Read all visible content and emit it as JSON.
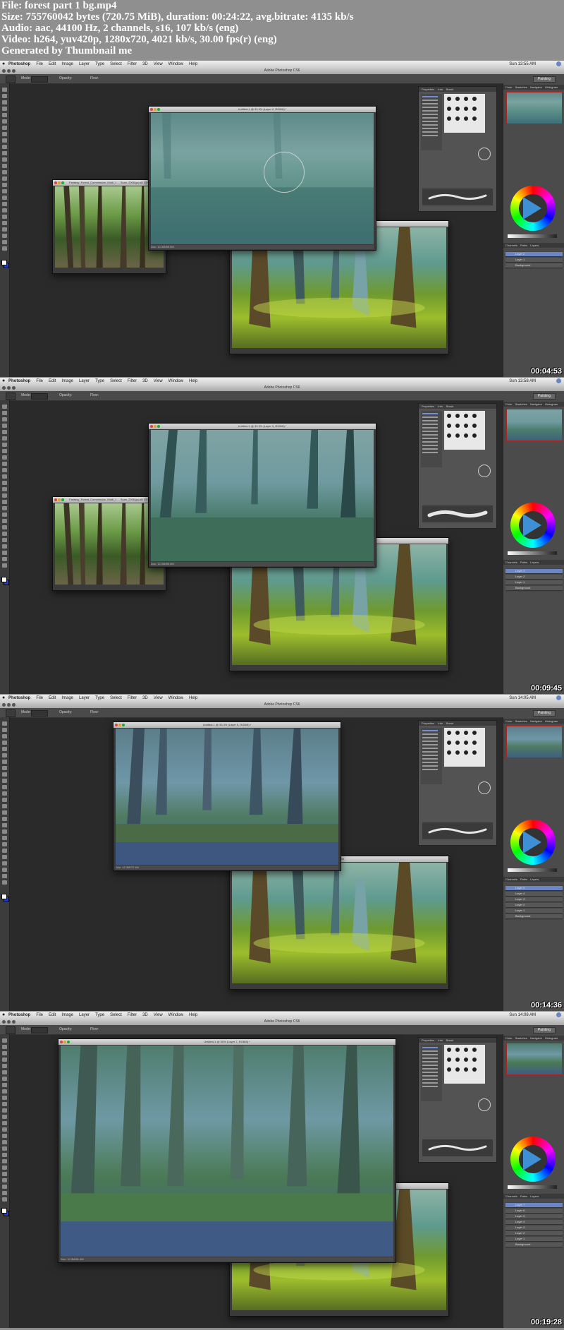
{
  "info": {
    "file": "File: forest part 1 bg.mp4",
    "size": "Size: 755760042 bytes (720.75 MiB), duration: 00:24:22, avg.bitrate: 4135 kb/s",
    "audio": "Audio: aac, 44100 Hz, 2 channels, s16, 107 kb/s (eng)",
    "video": "Video: h264, yuv420p, 1280x720, 4021 kb/s, 30.00 fps(r) (eng)",
    "generator": "Generated by Thumbnail me"
  },
  "app": {
    "apple": "",
    "menus": [
      "Photoshop",
      "File",
      "Edit",
      "Image",
      "Layer",
      "Type",
      "Select",
      "Filter",
      "3D",
      "View",
      "Window",
      "Help"
    ],
    "window_title": "Adobe Photoshop CS6",
    "workspace": "Painting",
    "mode_label": "Mode:",
    "opacity_label": "Opacity:",
    "flow_label": "Flow:",
    "brush_tabs": [
      "Properties",
      "Info",
      "Brush"
    ],
    "right_tabs": [
      "Color",
      "Swatches",
      "Navigator",
      "Histogram"
    ],
    "layers_tabs": [
      "Channels",
      "Paths",
      "Layers"
    ]
  },
  "frames": [
    {
      "timecode": "00:04:53",
      "clock": "Sun 13:55 AM",
      "doc_main_title": "Untitled-1 @ 33.3% (Layer 2, RGB/8) *",
      "doc_main_status": "Doc: 12.3M/65.5M",
      "doc_ref_title": "Fantasy_Forest_Commission_Multi_1 ... Scan_2008.jpg @ 33%",
      "doc_ref2_title": "",
      "has_small_ref": true,
      "layers": [
        "Layer 2",
        "Layer 1",
        "Background"
      ]
    },
    {
      "timecode": "00:09:45",
      "clock": "Sun 13:58 AM",
      "doc_main_title": "Untitled-1 @ 33.3% (Layer 3, RGB/8) *",
      "doc_main_status": "Doc: 12.3M/65.5M",
      "doc_ref_title": "Fantasy_Forest_Commission_Multi_1 ... Scan_2008.jpg @ 33%",
      "doc_ref2_title": "",
      "has_small_ref": true,
      "layers": [
        "Layer 3",
        "Layer 2",
        "Layer 1",
        "Background"
      ]
    },
    {
      "timecode": "00:14:36",
      "clock": "Sun 14:05 AM",
      "doc_main_title": "Untitled-1 @ 33.3% (Layer 5, RGB/8) *",
      "doc_main_status": "Doc: 12.3M/72.1M",
      "doc_ref_title": "",
      "doc_ref2_title": "RGB/8#",
      "has_small_ref": false,
      "layers": [
        "Layer 5",
        "Layer 4",
        "Layer 3",
        "Layer 2",
        "Layer 1",
        "Background"
      ]
    },
    {
      "timecode": "00:19:28",
      "clock": "Sun 14:08 AM",
      "doc_main_title": "Untitled-1 @ 50% (Layer 7, RGB/8) *",
      "doc_main_status": "Doc: 12.3M/81.4M",
      "doc_ref_title": "",
      "doc_ref2_title": "",
      "has_small_ref": false,
      "layers": [
        "Layer 7",
        "Layer 6",
        "Layer 5",
        "Layer 4",
        "Layer 3",
        "Layer 2",
        "Layer 1",
        "Background"
      ]
    }
  ]
}
